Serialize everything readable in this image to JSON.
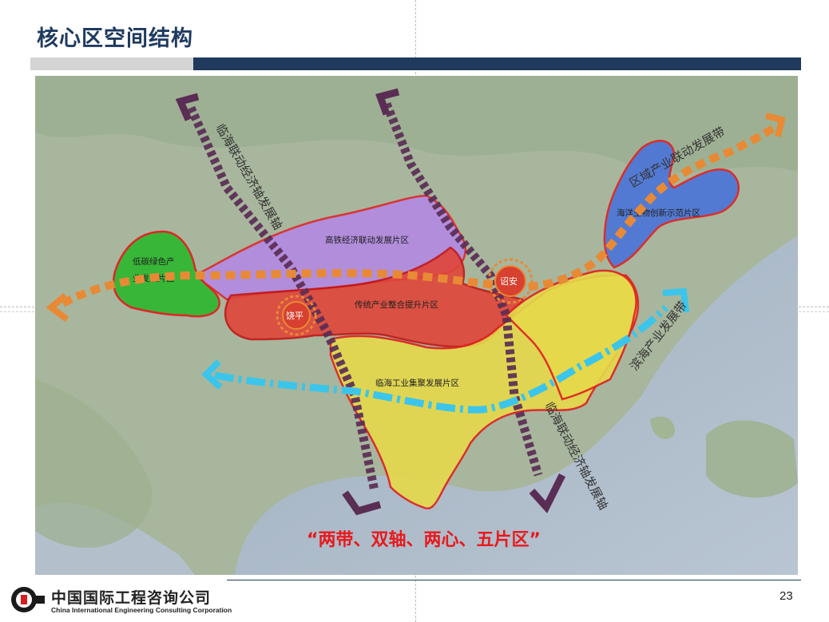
{
  "header": {
    "title": "核心区空间结构"
  },
  "map": {
    "zones": [
      {
        "label": "高铁经济联动发展片区",
        "color": "#b487e6"
      },
      {
        "label": "传统产业整合提升片区",
        "color": "#e0453a"
      },
      {
        "label": "临海工业集聚发展片区",
        "color": "#e6d94a"
      },
      {
        "label": "海洋生物创新示范片区",
        "color": "#4a74d8"
      },
      {
        "label": "低碳绿色产",
        "label2": "业发展片区",
        "color": "#33b733"
      }
    ],
    "centers": [
      {
        "label": "饶平"
      },
      {
        "label": "诏安"
      }
    ],
    "axes": [
      {
        "label": "临海联动经济轴发展轴",
        "color": "#5a2d55"
      },
      {
        "label": "临海联动经济轴发展轴",
        "color": "#5a2d55"
      }
    ],
    "belts": [
      {
        "label": "区域产业联动发展带",
        "color": "#e88a35"
      },
      {
        "label": "滨海产业发展带",
        "color": "#3cc5ea"
      }
    ],
    "slogan": "“两带、双轴、两心、五片区”"
  },
  "footer": {
    "company_cn": "中国国际工程咨询公司",
    "company_en": "China International Engineering Consulting Corporation",
    "page_number": "23"
  }
}
